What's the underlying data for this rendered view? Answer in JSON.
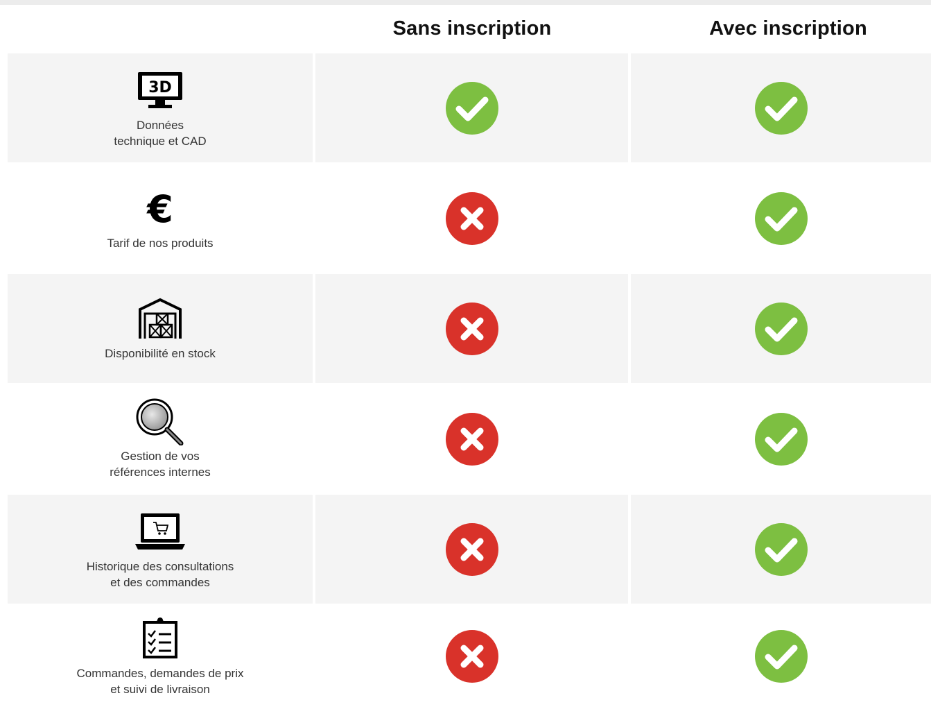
{
  "columns": {
    "sans": "Sans inscription",
    "avec": "Avec inscription"
  },
  "colors": {
    "check": "#7dbf41",
    "cross": "#d9322a",
    "row_shade": "#f4f4f4"
  },
  "rows": [
    {
      "icon": "monitor-3d-icon",
      "icon_text": "3D",
      "label": "Données\ntechnique et CAD",
      "sans": "yes",
      "avec": "yes"
    },
    {
      "icon": "euro-icon",
      "icon_text": "€",
      "label": "Tarif de nos produits",
      "sans": "no",
      "avec": "yes"
    },
    {
      "icon": "warehouse-icon",
      "label": "Disponibilité en stock",
      "sans": "no",
      "avec": "yes"
    },
    {
      "icon": "magnifier-icon",
      "label": "Gestion de vos\nréférences internes",
      "sans": "no",
      "avec": "yes"
    },
    {
      "icon": "laptop-cart-icon",
      "label": "Historique des consultations\net des commandes",
      "sans": "no",
      "avec": "yes"
    },
    {
      "icon": "checklist-icon",
      "label": "Commandes, demandes de prix\net suivi de livraison",
      "sans": "no",
      "avec": "yes"
    }
  ]
}
